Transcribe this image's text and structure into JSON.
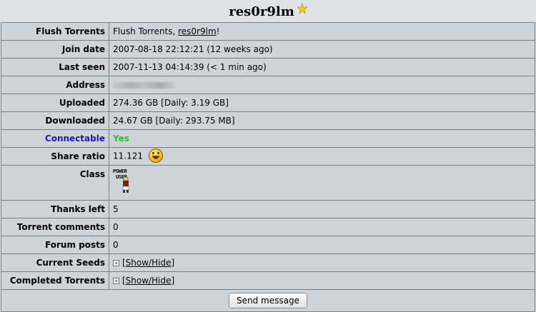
{
  "header": {
    "username": "res0r9lm",
    "star_icon": "star-icon"
  },
  "rows": {
    "flush_torrents": {
      "label": "Flush Torrents",
      "text": "Flush Torrents, ",
      "link": "res0r9lm",
      "suffix": "!"
    },
    "join_date": {
      "label": "Join date",
      "value": "2007-08-18 22:12:21 (12 weeks ago)"
    },
    "last_seen": {
      "label": "Last seen",
      "value": "2007-11-13 04:14:39 (< 1 min ago)"
    },
    "address": {
      "label": "Address"
    },
    "uploaded": {
      "label": "Uploaded",
      "value": "274.36 GB [Daily: 3.19 GB]"
    },
    "downloaded": {
      "label": "Downloaded",
      "value": "24.67 GB [Daily: 293.75 MB]"
    },
    "connectable": {
      "label": "Connectable",
      "value": "Yes",
      "label_color": "#1a1ab8",
      "value_color": "#27c227"
    },
    "share_ratio": {
      "label": "Share ratio",
      "value": "11.121",
      "icon": "smiley-icon"
    },
    "class": {
      "label": "Class",
      "badge_line1": "POWER",
      "badge_line2": "USER"
    },
    "thanks_left": {
      "label": "Thanks left",
      "value": "5"
    },
    "torrent_comments": {
      "label": "Torrent comments",
      "value": "0"
    },
    "forum_posts": {
      "label": "Forum posts",
      "value": "0"
    },
    "current_seeds": {
      "label": "Current Seeds",
      "toggle": "[Show/Hide]"
    },
    "completed_torrents": {
      "label": "Completed Torrents",
      "toggle": "[Show/Hide]"
    }
  },
  "footer": {
    "send_message_label": "Send message"
  }
}
